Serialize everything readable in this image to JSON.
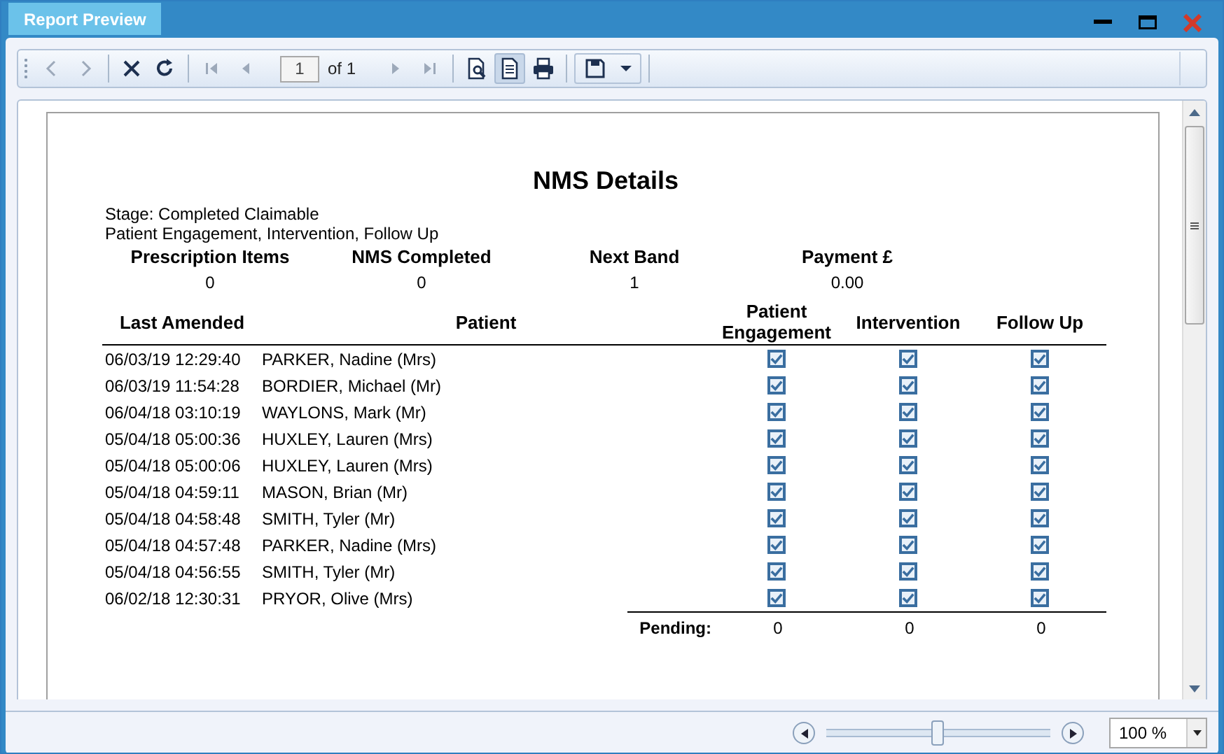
{
  "window": {
    "title": "Report Preview"
  },
  "toolbar": {
    "items": [
      {
        "kind": "back",
        "disabled": true
      },
      {
        "kind": "forward",
        "disabled": true
      },
      {
        "kind": "sep"
      },
      {
        "kind": "stop",
        "disabled": false
      },
      {
        "kind": "refresh",
        "disabled": false
      },
      {
        "kind": "sep"
      },
      {
        "kind": "first",
        "disabled": true
      },
      {
        "kind": "prev",
        "disabled": true
      },
      {
        "kind": "page"
      },
      {
        "kind": "next",
        "disabled": true
      },
      {
        "kind": "last",
        "disabled": true
      },
      {
        "kind": "sep"
      },
      {
        "kind": "setup",
        "disabled": false,
        "selected": false
      },
      {
        "kind": "single",
        "disabled": false,
        "selected": true
      },
      {
        "kind": "print",
        "disabled": false,
        "selected": false
      },
      {
        "kind": "sep"
      },
      {
        "kind": "save"
      },
      {
        "kind": "sep"
      }
    ],
    "page_number": "1",
    "page_count": "of 1"
  },
  "report": {
    "title": "NMS Details",
    "stage": "Stage: Completed Claimable",
    "subtitle": "Patient Engagement, Intervention, Follow Up",
    "summary": {
      "columns": [
        "Prescription Items",
        "NMS Completed",
        "Next Band",
        "Payment £"
      ],
      "values": [
        "0",
        "0",
        "1",
        "0.00"
      ]
    },
    "columns": [
      "Last Amended",
      "Patient",
      "Patient Engagement",
      "Intervention",
      "Follow Up"
    ],
    "rows": [
      {
        "last_amended": "06/03/19 12:29:40",
        "patient": "PARKER, Nadine (Mrs)",
        "engagement": true,
        "intervention": true,
        "follow_up": true
      },
      {
        "last_amended": "06/03/19 11:54:28",
        "patient": "BORDIER, Michael (Mr)",
        "engagement": true,
        "intervention": true,
        "follow_up": true
      },
      {
        "last_amended": "06/04/18 03:10:19",
        "patient": "WAYLONS, Mark (Mr)",
        "engagement": true,
        "intervention": true,
        "follow_up": true
      },
      {
        "last_amended": "05/04/18 05:00:36",
        "patient": "HUXLEY, Lauren (Mrs)",
        "engagement": true,
        "intervention": true,
        "follow_up": true
      },
      {
        "last_amended": "05/04/18 05:00:06",
        "patient": "HUXLEY, Lauren (Mrs)",
        "engagement": true,
        "intervention": true,
        "follow_up": true
      },
      {
        "last_amended": "05/04/18 04:59:11",
        "patient": "MASON, Brian (Mr)",
        "engagement": true,
        "intervention": true,
        "follow_up": true
      },
      {
        "last_amended": "05/04/18 04:58:48",
        "patient": "SMITH, Tyler (Mr)",
        "engagement": true,
        "intervention": true,
        "follow_up": true
      },
      {
        "last_amended": "05/04/18 04:57:48",
        "patient": "PARKER, Nadine (Mrs)",
        "engagement": true,
        "intervention": true,
        "follow_up": true
      },
      {
        "last_amended": "05/04/18 04:56:55",
        "patient": "SMITH, Tyler (Mr)",
        "engagement": true,
        "intervention": true,
        "follow_up": true
      },
      {
        "last_amended": "06/02/18 12:30:31",
        "patient": "PRYOR, Olive (Mrs)",
        "engagement": true,
        "intervention": true,
        "follow_up": true
      }
    ],
    "pending": {
      "label": "Pending:",
      "values": [
        "0",
        "0",
        "0"
      ]
    }
  },
  "zoom": {
    "level": 0.5,
    "value": "100 %"
  }
}
